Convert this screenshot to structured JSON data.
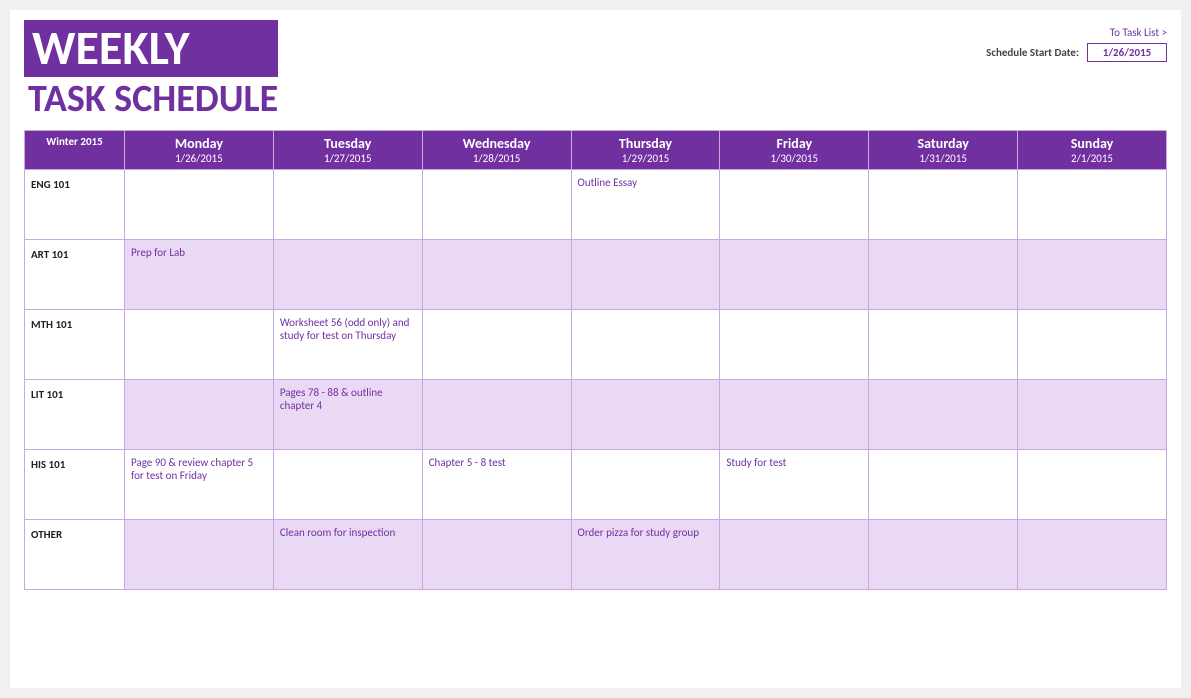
{
  "header": {
    "title_line1": "WEEKLY",
    "title_line2": "TASK SCHEDULE",
    "to_task_list": "To Task List >",
    "schedule_start_label": "Schedule Start Date:",
    "schedule_start_value": "1/26/2015"
  },
  "table": {
    "header_row_label": "Winter 2015",
    "columns": [
      {
        "day": "Monday",
        "date": "1/26/2015"
      },
      {
        "day": "Tuesday",
        "date": "1/27/2015"
      },
      {
        "day": "Wednesday",
        "date": "1/28/2015"
      },
      {
        "day": "Thursday",
        "date": "1/29/2015"
      },
      {
        "day": "Friday",
        "date": "1/30/2015"
      },
      {
        "day": "Saturday",
        "date": "1/31/2015"
      },
      {
        "day": "Sunday",
        "date": "2/1/2015"
      }
    ],
    "rows": [
      {
        "label": "ENG 101",
        "cells": [
          "",
          "",
          "",
          "Outline Essay",
          "",
          "",
          ""
        ],
        "style": "white"
      },
      {
        "label": "ART 101",
        "cells": [
          "Prep for Lab",
          "",
          "",
          "",
          "",
          "",
          ""
        ],
        "style": "lavender"
      },
      {
        "label": "MTH 101",
        "cells": [
          "",
          "Worksheet 56 (odd only) and study for test on Thursday",
          "",
          "",
          "",
          "",
          ""
        ],
        "style": "white"
      },
      {
        "label": "LIT 101",
        "cells": [
          "",
          "Pages 78 - 88 & outline chapter 4",
          "",
          "",
          "",
          "",
          ""
        ],
        "style": "lavender"
      },
      {
        "label": "HIS 101",
        "cells": [
          "Page 90 & review chapter 5 for test on Friday",
          "",
          "Chapter 5 - 8 test",
          "",
          "Study for test",
          "",
          ""
        ],
        "style": "white"
      },
      {
        "label": "OTHER",
        "cells": [
          "",
          "Clean room for inspection",
          "",
          "Order pizza for study group",
          "",
          "",
          ""
        ],
        "style": "lavender"
      }
    ]
  }
}
